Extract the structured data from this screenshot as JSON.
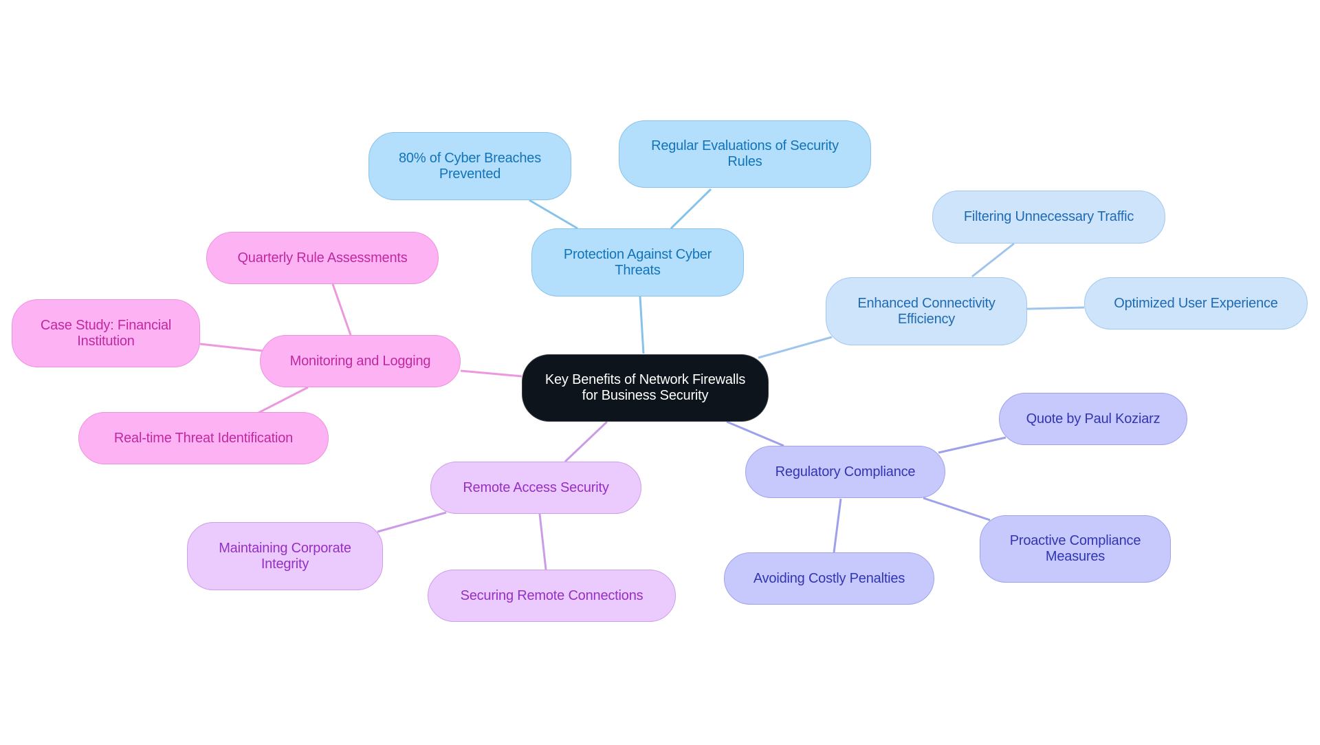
{
  "diagram": {
    "type": "mind-map",
    "root": {
      "id": "root",
      "label": "Key Benefits of Network Firewalls for Business Security"
    },
    "colors": {
      "root_fill": "#0d141b",
      "protection": {
        "fill": "#b3dffc",
        "stroke": "#89c2ea",
        "text": "#1273b8",
        "edge": "#86c3ea"
      },
      "connectivity": {
        "fill": "#cde4fb",
        "stroke": "#a3c7ee",
        "text": "#1e6ab3",
        "edge": "#9ec5ee"
      },
      "monitoring": {
        "fill": "#fdb3f3",
        "stroke": "#eb91df",
        "text": "#c0289f",
        "edge": "#ec97de"
      },
      "remote": {
        "fill": "#ebcafd",
        "stroke": "#cd9ee9",
        "text": "#9530c2",
        "edge": "#cc9be8"
      },
      "regulatory": {
        "fill": "#c7c9fc",
        "stroke": "#9fa2ec",
        "text": "#3135b3",
        "edge": "#9da0ea"
      }
    },
    "branches": [
      {
        "id": "protection",
        "label": "Protection Against Cyber Threats",
        "children": [
          {
            "id": "p1",
            "label": "80% of Cyber Breaches Prevented"
          },
          {
            "id": "p2",
            "label": "Regular Evaluations of Security Rules"
          }
        ]
      },
      {
        "id": "connectivity",
        "label": "Enhanced Connectivity Efficiency",
        "children": [
          {
            "id": "c1",
            "label": "Filtering Unnecessary Traffic"
          },
          {
            "id": "c2",
            "label": "Optimized User Experience"
          }
        ]
      },
      {
        "id": "regulatory",
        "label": "Regulatory Compliance",
        "children": [
          {
            "id": "r1",
            "label": "Quote by Paul Koziarz"
          },
          {
            "id": "r2",
            "label": "Proactive Compliance Measures"
          },
          {
            "id": "r3",
            "label": "Avoiding Costly Penalties"
          }
        ]
      },
      {
        "id": "remote",
        "label": "Remote Access Security",
        "children": [
          {
            "id": "ra1",
            "label": "Maintaining Corporate Integrity"
          },
          {
            "id": "ra2",
            "label": "Securing Remote Connections"
          }
        ]
      },
      {
        "id": "monitoring",
        "label": "Monitoring and Logging",
        "children": [
          {
            "id": "m1",
            "label": "Quarterly Rule Assessments"
          },
          {
            "id": "m2",
            "label": "Case Study: Financial Institution"
          },
          {
            "id": "m3",
            "label": "Real-time Threat Identification"
          }
        ]
      }
    ]
  }
}
